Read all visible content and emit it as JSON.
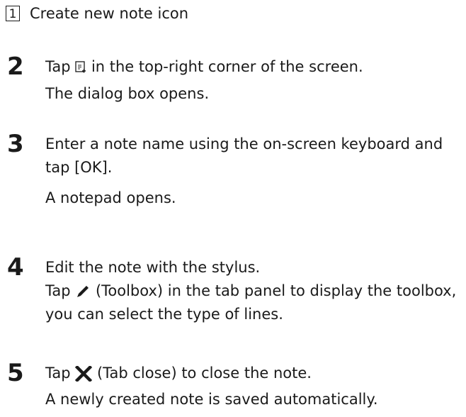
{
  "callout": {
    "number": "1",
    "text": "Create new note icon"
  },
  "steps": [
    {
      "number": "2",
      "instruction_before": "Tap",
      "icon": "create-note-icon",
      "instruction_after": "in the top-right corner of the screen.",
      "result": "The dialog box opens."
    },
    {
      "number": "3",
      "instruction": "Enter a note name using the on-screen keyboard and tap [OK].",
      "result": "A notepad opens."
    },
    {
      "number": "4",
      "instruction": "Edit the note with the stylus.",
      "detail_before": "Tap",
      "icon": "pen-icon",
      "detail_after": "(Toolbox) in the tab panel to display the toolbox, you can select the type of lines."
    },
    {
      "number": "5",
      "instruction_before": "Tap",
      "icon": "close-x-icon",
      "instruction_after": "(Tab close) to close the note.",
      "result": "A newly created note is saved automatically."
    }
  ]
}
